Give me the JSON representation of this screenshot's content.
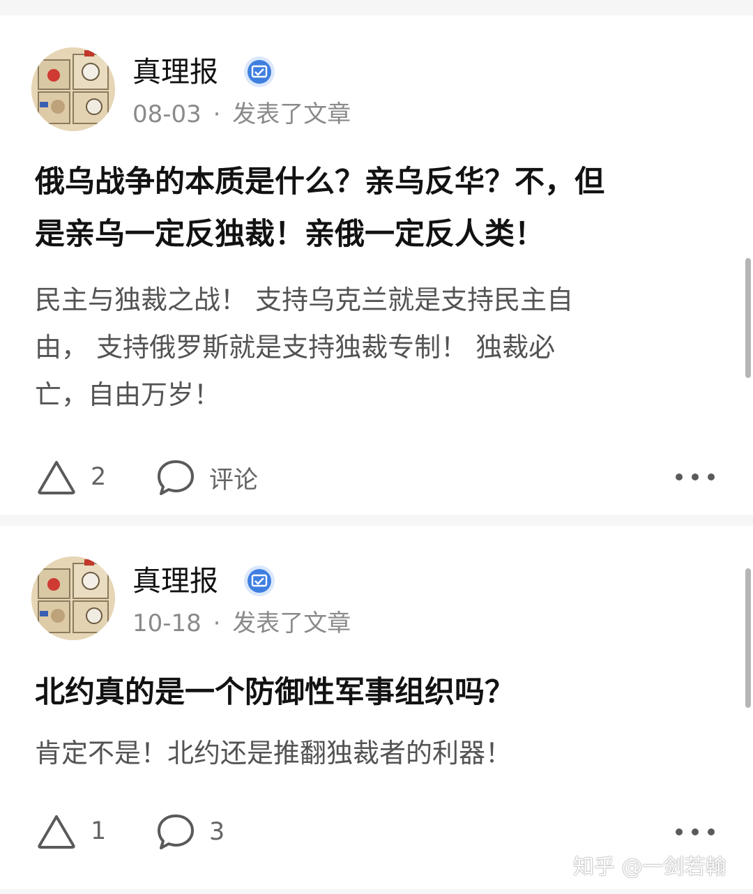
{
  "posts": [
    {
      "author": "真理报",
      "date": "08-03",
      "separator": "·",
      "action": "发表了文章",
      "title_lines": [
        "俄乌战争的本质是什么？亲乌反华？不，但",
        "是亲乌一定反独裁！亲俄一定反人类！"
      ],
      "excerpt_lines": [
        "民主与独裁之战！ 支持乌克兰就是支持民主自",
        "由， 支持俄罗斯就是支持独裁专制！ 独裁必",
        "亡，自由万岁！"
      ],
      "likes": "2",
      "comments": "评论"
    },
    {
      "author": "真理报",
      "date": "10-18",
      "separator": "·",
      "action": "发表了文章",
      "title_lines": [
        "北约真的是一个防御性军事组织吗？"
      ],
      "excerpt_lines": [
        "肯定不是！北约还是推翻独裁者的利器！"
      ],
      "likes": "1",
      "comments": "3"
    }
  ],
  "watermark": "知乎 @一剑若翰",
  "icons": {
    "like": "upvote-triangle-icon",
    "comment": "comment-bubble-icon",
    "more": "more-dots-icon",
    "verified": "verified-badge-icon"
  },
  "colors": {
    "verified": "#3f7fe0",
    "text_primary": "#121212",
    "text_secondary": "#535353",
    "text_meta": "#8a8a8a"
  }
}
